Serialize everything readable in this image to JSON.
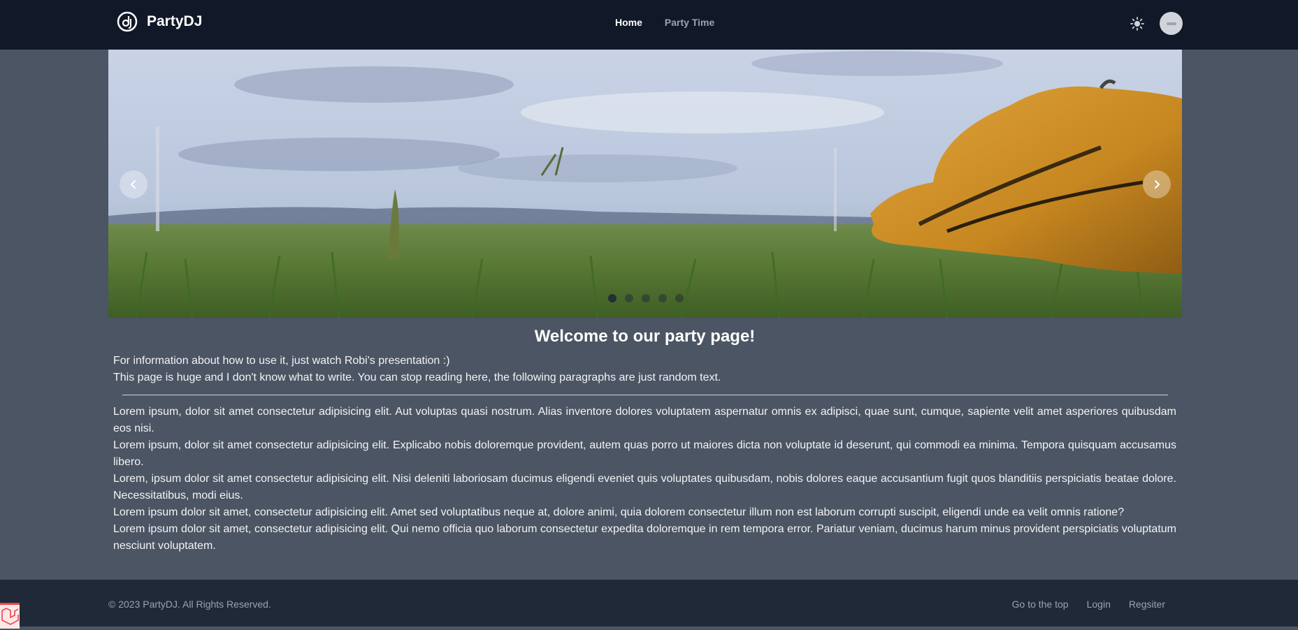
{
  "brand": {
    "name": "PartyDJ",
    "icon": "dj-logo-icon"
  },
  "nav": {
    "links": [
      {
        "label": "Home",
        "active": true
      },
      {
        "label": "Party Time",
        "active": false
      }
    ]
  },
  "header": {
    "theme_icon": "sun-icon",
    "avatar_icon": "avatar"
  },
  "carousel": {
    "slide_count": 5,
    "active_index": 0,
    "prev_icon": "chevron-left-icon",
    "next_icon": "chevron-right-icon"
  },
  "main": {
    "title": "Welcome to our party page!",
    "intro": [
      "For information about how to use it, just watch Robi's presentation :)",
      "This page is huge and I don't know what to write. You can stop reading here, the following paragraphs are just random text."
    ],
    "paragraphs": [
      "Lorem ipsum, dolor sit amet consectetur adipisicing elit. Aut voluptas quasi nostrum. Alias inventore dolores voluptatem aspernatur omnis ex adipisci, quae sunt, cumque, sapiente velit amet asperiores quibusdam eos nisi.",
      "Lorem ipsum, dolor sit amet consectetur adipisicing elit. Explicabo nobis doloremque provident, autem quas porro ut maiores dicta non voluptate id deserunt, qui commodi ea minima. Tempora quisquam accusamus libero.",
      "Lorem, ipsum dolor sit amet consectetur adipisicing elit. Nisi deleniti laboriosam ducimus eligendi eveniet quis voluptates quibusdam, nobis dolores eaque accusantium fugit quos blanditiis perspiciatis beatae dolore. Necessitatibus, modi eius.",
      "Lorem ipsum dolor sit amet, consectetur adipisicing elit. Amet sed voluptatibus neque at, dolore animi, quia dolorem consectetur illum non est laborum corrupti suscipit, eligendi unde ea velit omnis ratione?",
      "Lorem ipsum dolor sit amet, consectetur adipisicing elit. Qui nemo officia quo laborum consectetur expedita doloremque in rem tempora error. Pariatur veniam, ducimus harum minus provident perspiciatis voluptatum nesciunt voluptatem."
    ]
  },
  "footer": {
    "copyright": "© 2023 PartyDJ. All Rights Reserved.",
    "links": [
      "Go to the top",
      "Login",
      "Regsiter"
    ]
  },
  "colors": {
    "navbar": "#111827",
    "page": "#4b5563",
    "footer": "#1f2937",
    "accent": "#ef4444"
  }
}
